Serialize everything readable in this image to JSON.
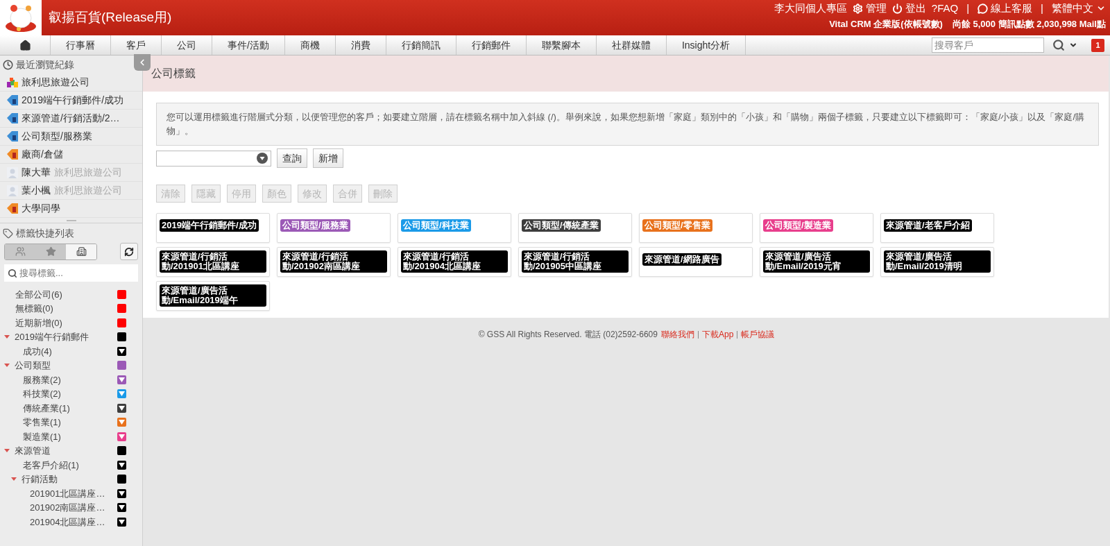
{
  "header": {
    "app_title": "叡揚百貨(Release用)",
    "links": [
      {
        "kind": "text",
        "label": "李大同個人專區"
      },
      {
        "kind": "settings",
        "label": "管理"
      },
      {
        "kind": "logout",
        "label": "登出"
      },
      {
        "kind": "text",
        "label": "?FAQ"
      },
      {
        "kind": "separator",
        "label": "|"
      },
      {
        "kind": "chat",
        "label": "線上客服"
      },
      {
        "kind": "separator",
        "label": "|"
      },
      {
        "kind": "language",
        "label": "繁體中文"
      }
    ],
    "plan": "Vital CRM 企業版(依帳號數)",
    "quota": "尚餘 5,000 簡訊點數 2,030,998 Mail點"
  },
  "nav": {
    "items": [
      "行事曆",
      "客戶",
      "公司",
      "事件/活動",
      "商機",
      "消費",
      "行銷簡訊",
      "行銷郵件",
      "聯繫腳本",
      "社群媒體",
      "Insight分析"
    ],
    "search_placeholder": "搜尋客戶",
    "badge": "1"
  },
  "sidebar": {
    "recent_title": "最近瀏覽紀錄",
    "recent": [
      {
        "kind": "company",
        "label": "旅利思旅遊公司"
      },
      {
        "kind": "tag",
        "label": "2019端午行銷郵件/成功"
      },
      {
        "kind": "tag",
        "label": "來源管道/行銷活動/2…"
      },
      {
        "kind": "tag",
        "label": "公司類型/服務業"
      },
      {
        "kind": "group",
        "label": "廠商/倉儲"
      },
      {
        "kind": "person",
        "label": "陳大華",
        "company": "旅利思旅遊公司"
      },
      {
        "kind": "person",
        "label": "葉小楓",
        "company": "旅利思旅遊公司"
      },
      {
        "kind": "group",
        "label": "大學同學"
      }
    ],
    "tags_title": "標籤快捷列表",
    "toggle": [
      {
        "kind": "people",
        "selected": false
      },
      {
        "kind": "star",
        "selected": false
      },
      {
        "kind": "building",
        "selected": true
      }
    ],
    "tag_search_placeholder": "搜尋標籤...",
    "tree": [
      {
        "label": "全部公司(6)",
        "color": "#ff0000",
        "kind": "plain"
      },
      {
        "label": "無標籤(0)",
        "color": "#ff0000",
        "kind": "plain"
      },
      {
        "label": "近期新增(0)",
        "color": "#ff0000",
        "kind": "plain"
      },
      {
        "label": "2019端午行銷郵件",
        "color": "#000000",
        "kind": "plain",
        "expanded": true,
        "children": [
          {
            "label": "成功(4)",
            "color": "#000000",
            "kind": "menu"
          }
        ]
      },
      {
        "label": "公司類型",
        "color": "#9b59b6",
        "kind": "plain",
        "expanded": true,
        "children": [
          {
            "label": "服務業(2)",
            "color": "#9b59b6",
            "kind": "menu"
          },
          {
            "label": "科技業(2)",
            "color": "#1a9ae8",
            "kind": "menu"
          },
          {
            "label": "傳統產業(1)",
            "color": "#3d3d3d",
            "kind": "menu"
          },
          {
            "label": "零售業(1)",
            "color": "#e8711c",
            "kind": "menu"
          },
          {
            "label": "製造業(1)",
            "color": "#e83e8c",
            "kind": "menu"
          }
        ]
      },
      {
        "label": "來源管道",
        "color": "#000000",
        "kind": "plain",
        "expanded": true,
        "children": [
          {
            "label": "老客戶介紹(1)",
            "color": "#000000",
            "kind": "menu"
          },
          {
            "label": "行銷活動",
            "color": "#000000",
            "kind": "plain",
            "expanded": true,
            "children": [
              {
                "label": "201901北區講座…",
                "color": "#000000",
                "kind": "menu"
              },
              {
                "label": "201902南區講座…",
                "color": "#000000",
                "kind": "menu"
              },
              {
                "label": "201904北區講座…",
                "color": "#000000",
                "kind": "menu"
              }
            ]
          }
        ]
      }
    ]
  },
  "page_title": "公司標籤",
  "info": "您可以運用標籤進行階層式分類，以便管理您的客戶；如要建立階層，請在標籤名稱中加入斜線 (/)。舉例來說，如果您想新增「家庭」類別中的「小孩」和「購物」兩個子標籤，只要建立以下標籤即可：「家庭/小孩」以及「家庭/購物」。",
  "query_button": "查詢",
  "add_button": "新增",
  "actions": [
    {
      "label": "清除",
      "disabled": true
    },
    {
      "label": "隱藏",
      "disabled": true
    },
    {
      "label": "停用",
      "disabled": true
    },
    {
      "label": "顏色",
      "disabled": true
    },
    {
      "label": "修改",
      "disabled": true
    },
    {
      "label": "合併",
      "disabled": true
    },
    {
      "label": "刪除",
      "disabled": true
    }
  ],
  "tags": [
    {
      "text": "2019端午行銷郵件/成功",
      "color": "#000000"
    },
    {
      "text": "公司類型/服務業",
      "color": "#9b59b6"
    },
    {
      "text": "公司類型/科技業",
      "color": "#1a9ae8"
    },
    {
      "text": "公司類型/傳統產業",
      "color": "#3d3d3d"
    },
    {
      "text": "公司類型/零售業",
      "color": "#e8711c"
    },
    {
      "text": "公司類型/製造業",
      "color": "#e83e8c"
    },
    {
      "text": "來源管道/老客戶介紹",
      "color": "#000000"
    },
    {
      "text": "來源管道/行銷活動/201901北區講座",
      "color": "#000000"
    },
    {
      "text": "來源管道/行銷活動/201902南區講座",
      "color": "#000000"
    },
    {
      "text": "來源管道/行銷活動/201904北區講座",
      "color": "#000000"
    },
    {
      "text": "來源管道/行銷活動/201905中區講座",
      "color": "#000000"
    },
    {
      "text": "來源管道/網路廣告",
      "color": "#000000"
    },
    {
      "text": "來源管道/廣告活動/Email/2019元宵",
      "color": "#000000"
    },
    {
      "text": "來源管道/廣告活動/Email/2019清明",
      "color": "#000000"
    },
    {
      "text": "來源管道/廣告活動/Email/2019端午",
      "color": "#000000"
    }
  ],
  "footer": {
    "text": "© GSS All Rights Reserved. 電話 (02)2592-6609",
    "links": [
      "聯絡我們",
      "下載App",
      "帳戶協議"
    ]
  }
}
